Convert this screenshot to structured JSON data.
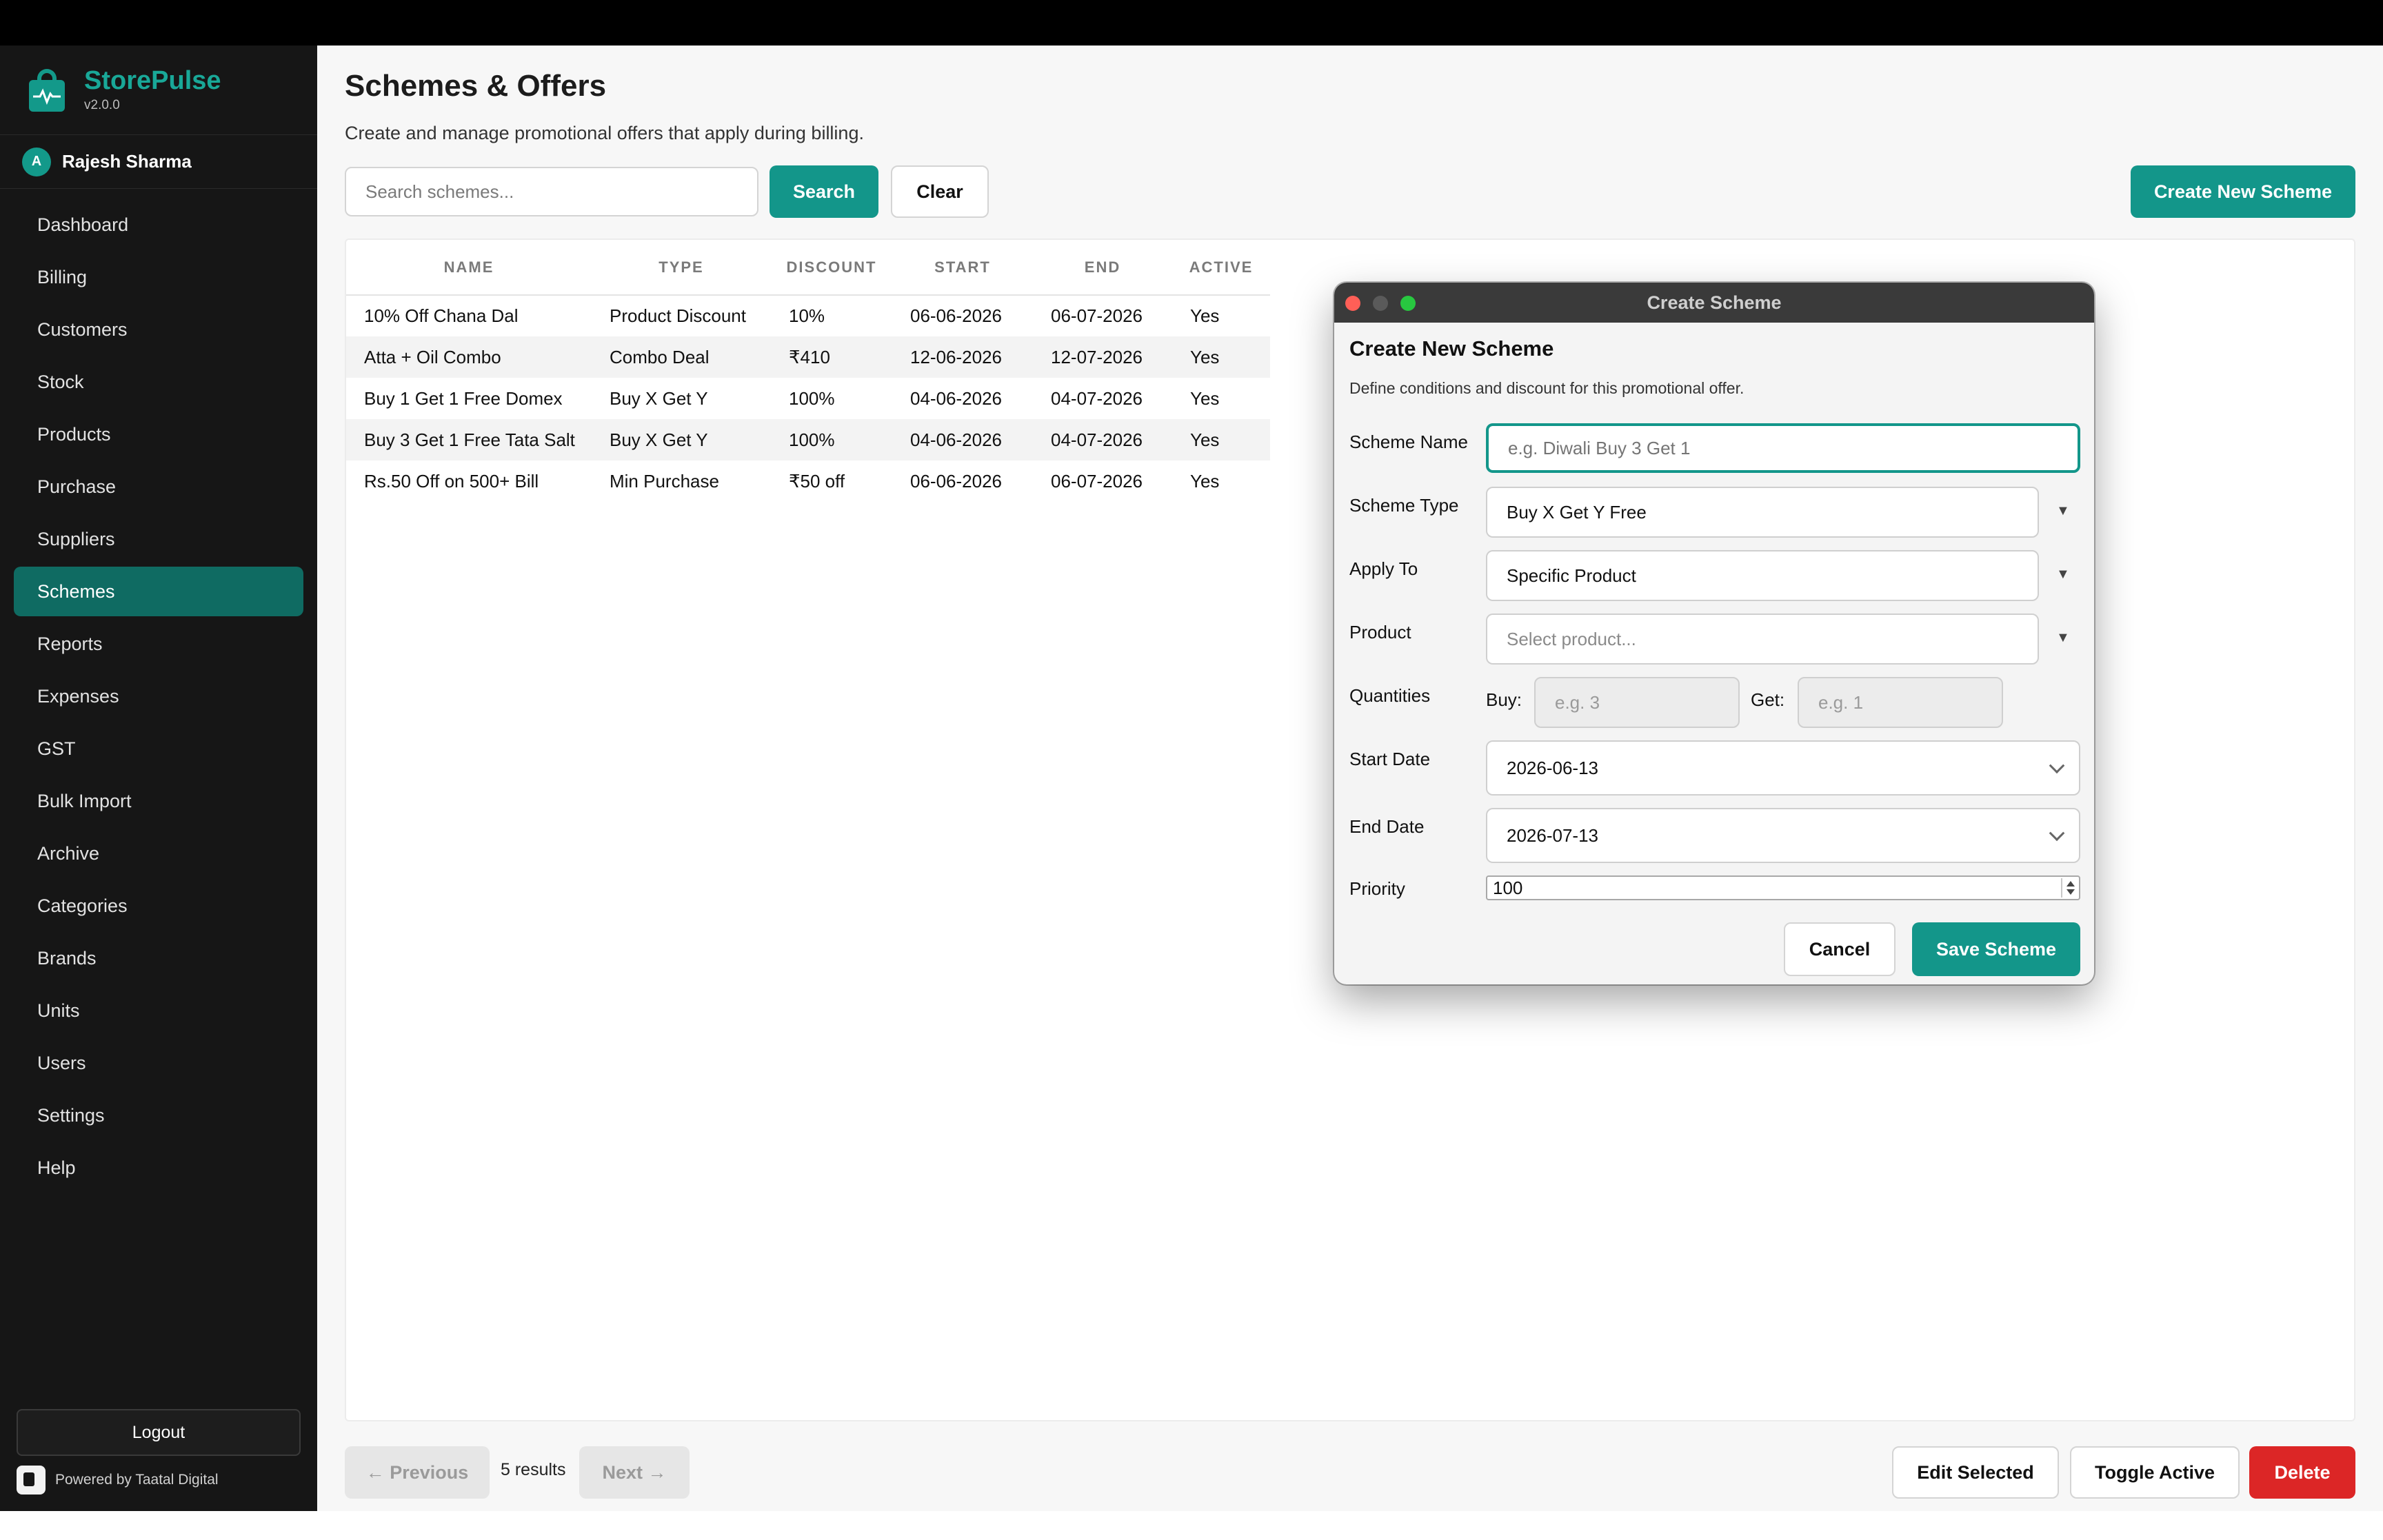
{
  "app": {
    "name": "StorePulse",
    "version": "v2.0.0"
  },
  "user": {
    "initial": "A",
    "name": "Rajesh Sharma"
  },
  "sidebar": {
    "items": [
      {
        "label": "Dashboard"
      },
      {
        "label": "Billing"
      },
      {
        "label": "Customers"
      },
      {
        "label": "Stock"
      },
      {
        "label": "Products"
      },
      {
        "label": "Purchase"
      },
      {
        "label": "Suppliers"
      },
      {
        "label": "Schemes"
      },
      {
        "label": "Reports"
      },
      {
        "label": "Expenses"
      },
      {
        "label": "GST"
      },
      {
        "label": "Bulk Import"
      },
      {
        "label": "Archive"
      },
      {
        "label": "Categories"
      },
      {
        "label": "Brands"
      },
      {
        "label": "Units"
      },
      {
        "label": "Users"
      },
      {
        "label": "Settings"
      },
      {
        "label": "Help"
      }
    ],
    "active": "Schemes",
    "logout_label": "Logout",
    "powered_by": "Powered by Taatal Digital"
  },
  "page": {
    "title": "Schemes & Offers",
    "subtitle": "Create and manage promotional offers that apply during billing."
  },
  "search": {
    "placeholder": "Search schemes...",
    "value": "",
    "search_label": "Search",
    "clear_label": "Clear"
  },
  "create_button_label": "Create New Scheme",
  "table": {
    "columns": [
      "NAME",
      "TYPE",
      "DISCOUNT",
      "START",
      "END",
      "ACTIVE"
    ],
    "rows": [
      [
        "10% Off Chana Dal",
        "Product Discount",
        "10%",
        "06-06-2026",
        "06-07-2026",
        "Yes"
      ],
      [
        "Atta + Oil Combo",
        "Combo Deal",
        "₹410",
        "12-06-2026",
        "12-07-2026",
        "Yes"
      ],
      [
        "Buy 1 Get 1 Free Domex",
        "Buy X Get Y",
        "100%",
        "04-06-2026",
        "04-07-2026",
        "Yes"
      ],
      [
        "Buy 3 Get 1 Free Tata Salt",
        "Buy X Get Y",
        "100%",
        "04-06-2026",
        "04-07-2026",
        "Yes"
      ],
      [
        "Rs.50 Off on 500+ Bill",
        "Min Purchase",
        "₹50 off",
        "06-06-2026",
        "06-07-2026",
        "Yes"
      ]
    ]
  },
  "footer": {
    "prev_label": "← Previous",
    "results": "5 results",
    "next_label": "Next →",
    "edit_label": "Edit Selected",
    "toggle_label": "Toggle Active",
    "delete_label": "Delete"
  },
  "dialog": {
    "window_title": "Create Scheme",
    "heading": "Create New Scheme",
    "subheading": "Define conditions and discount for this promotional offer.",
    "scheme_name": {
      "label": "Scheme Name",
      "placeholder": "e.g. Diwali Buy 3 Get 1",
      "value": ""
    },
    "scheme_type": {
      "label": "Scheme Type",
      "value": "Buy X Get Y Free"
    },
    "apply_to": {
      "label": "Apply To",
      "value": "Specific Product"
    },
    "product": {
      "label": "Product",
      "placeholder": "Select product..."
    },
    "quantities": {
      "label": "Quantities",
      "buy_label": "Buy:",
      "buy_placeholder": "e.g. 3",
      "get_label": "Get:",
      "get_placeholder": "e.g. 1"
    },
    "start_date": {
      "label": "Start Date",
      "value": "2026-06-13"
    },
    "end_date": {
      "label": "End Date",
      "value": "2026-07-13"
    },
    "priority": {
      "label": "Priority",
      "value": "100"
    },
    "cancel_label": "Cancel",
    "save_label": "Save Scheme"
  },
  "colors": {
    "accent": "#13968a",
    "danger": "#dc2626",
    "sidebar_bg": "#161616",
    "active_nav": "#0f6b62"
  },
  "icons": {
    "logo": "shopping-bag-pulse-icon",
    "caret": "caret-down-icon",
    "date_chevron": "chevron-down-icon"
  }
}
